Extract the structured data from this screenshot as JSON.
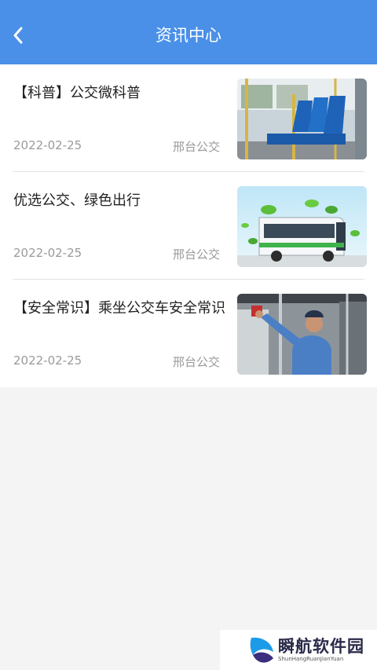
{
  "header": {
    "title": "资讯中心",
    "back_icon": "chevron-left-icon"
  },
  "colors": {
    "header_bg": "#4a90e8",
    "page_bg": "#f4f4f4"
  },
  "news": [
    {
      "title": "【科普】公交微科普",
      "date": "2022-02-25",
      "source": "邢台公交",
      "image": "bus-seats-image"
    },
    {
      "title": "优选公交、绿色出行",
      "date": "2022-02-25",
      "source": "邢台公交",
      "image": "green-bus-image"
    },
    {
      "title": "【安全常识】乘坐公交车安全常识",
      "date": "2022-02-25",
      "source": "邢台公交",
      "image": "bus-driver-image"
    }
  ],
  "watermark": {
    "name": "瞬航软件园",
    "pinyin": "ShunHangRuanJianYuan"
  }
}
